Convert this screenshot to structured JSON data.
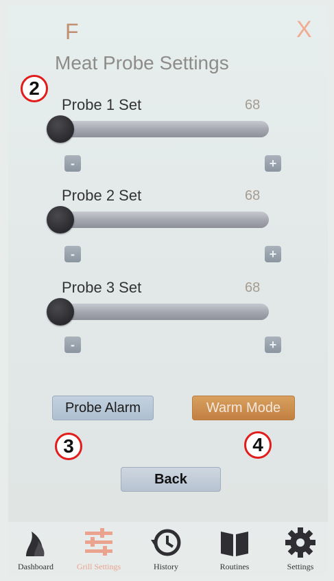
{
  "header": {
    "unit": "F",
    "close_label": "X",
    "title": "Meat Probe Settings"
  },
  "markers": [
    "2",
    "3",
    "4"
  ],
  "probes": [
    {
      "label": "Probe 1 Set",
      "value": "68",
      "level": 0,
      "minus": "-",
      "plus": "+"
    },
    {
      "label": "Probe 2 Set",
      "value": "68",
      "level": 0,
      "minus": "-",
      "plus": "+"
    },
    {
      "label": "Probe 3 Set",
      "value": "68",
      "level": 0,
      "minus": "-",
      "plus": "+"
    }
  ],
  "buttons": {
    "probe_alarm": "Probe Alarm",
    "warm_mode": "Warm Mode",
    "back": "Back"
  },
  "nav": [
    {
      "label": "Dashboard",
      "icon": "flame-icon",
      "active": false
    },
    {
      "label": "Grill Settings",
      "icon": "sliders-icon",
      "active": true
    },
    {
      "label": "History",
      "icon": "history-icon",
      "active": false
    },
    {
      "label": "Routines",
      "icon": "book-icon",
      "active": false
    },
    {
      "label": "Settings",
      "icon": "gear-icon",
      "active": false
    }
  ],
  "colors": {
    "accent": "#f2ab90",
    "warm_mode": "#c88a4c",
    "marker_ring": "#e21b1b",
    "nav_active": "#e9a38f"
  }
}
